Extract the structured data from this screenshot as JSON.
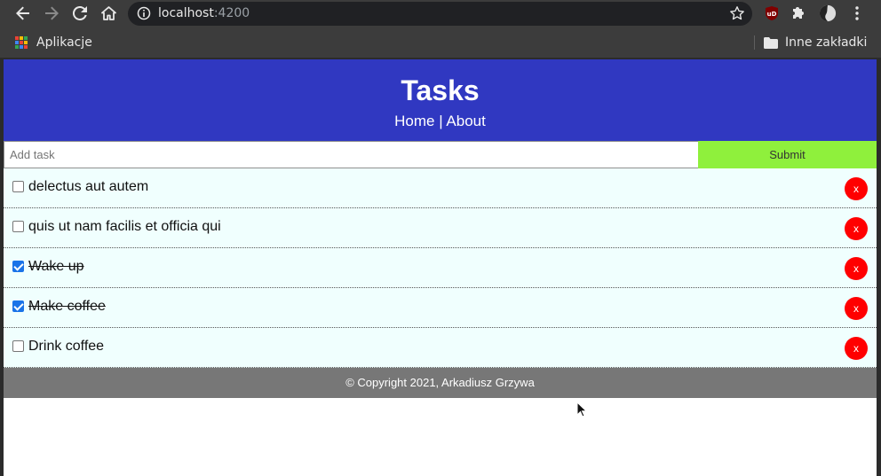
{
  "browser": {
    "url_host": "localhost",
    "url_port": ":4200",
    "bookmarks": {
      "apps_label": "Aplikacje",
      "other_label": "Inne zakładki"
    },
    "extension_label": "uD"
  },
  "page": {
    "title": "Tasks",
    "nav": {
      "home": "Home",
      "separator": " | ",
      "about": "About"
    },
    "form": {
      "placeholder": "Add task",
      "submit_label": "Submit"
    },
    "tasks": [
      {
        "text": "delectus aut autem",
        "done": false,
        "delete_label": "x"
      },
      {
        "text": "quis ut nam facilis et officia qui",
        "done": false,
        "delete_label": "x"
      },
      {
        "text": "Wake up",
        "done": true,
        "delete_label": "x"
      },
      {
        "text": "Make coffee",
        "done": true,
        "delete_label": "x"
      },
      {
        "text": "Drink coffee",
        "done": false,
        "delete_label": "x"
      }
    ],
    "footer": "© Copyright 2021, Arkadiusz Grzywa"
  },
  "colors": {
    "header_bg": "#3038c1",
    "submit_bg": "#8ff03c",
    "task_bg": "#f0fffe",
    "delete_bg": "#ff0000",
    "footer_bg": "#777777"
  }
}
